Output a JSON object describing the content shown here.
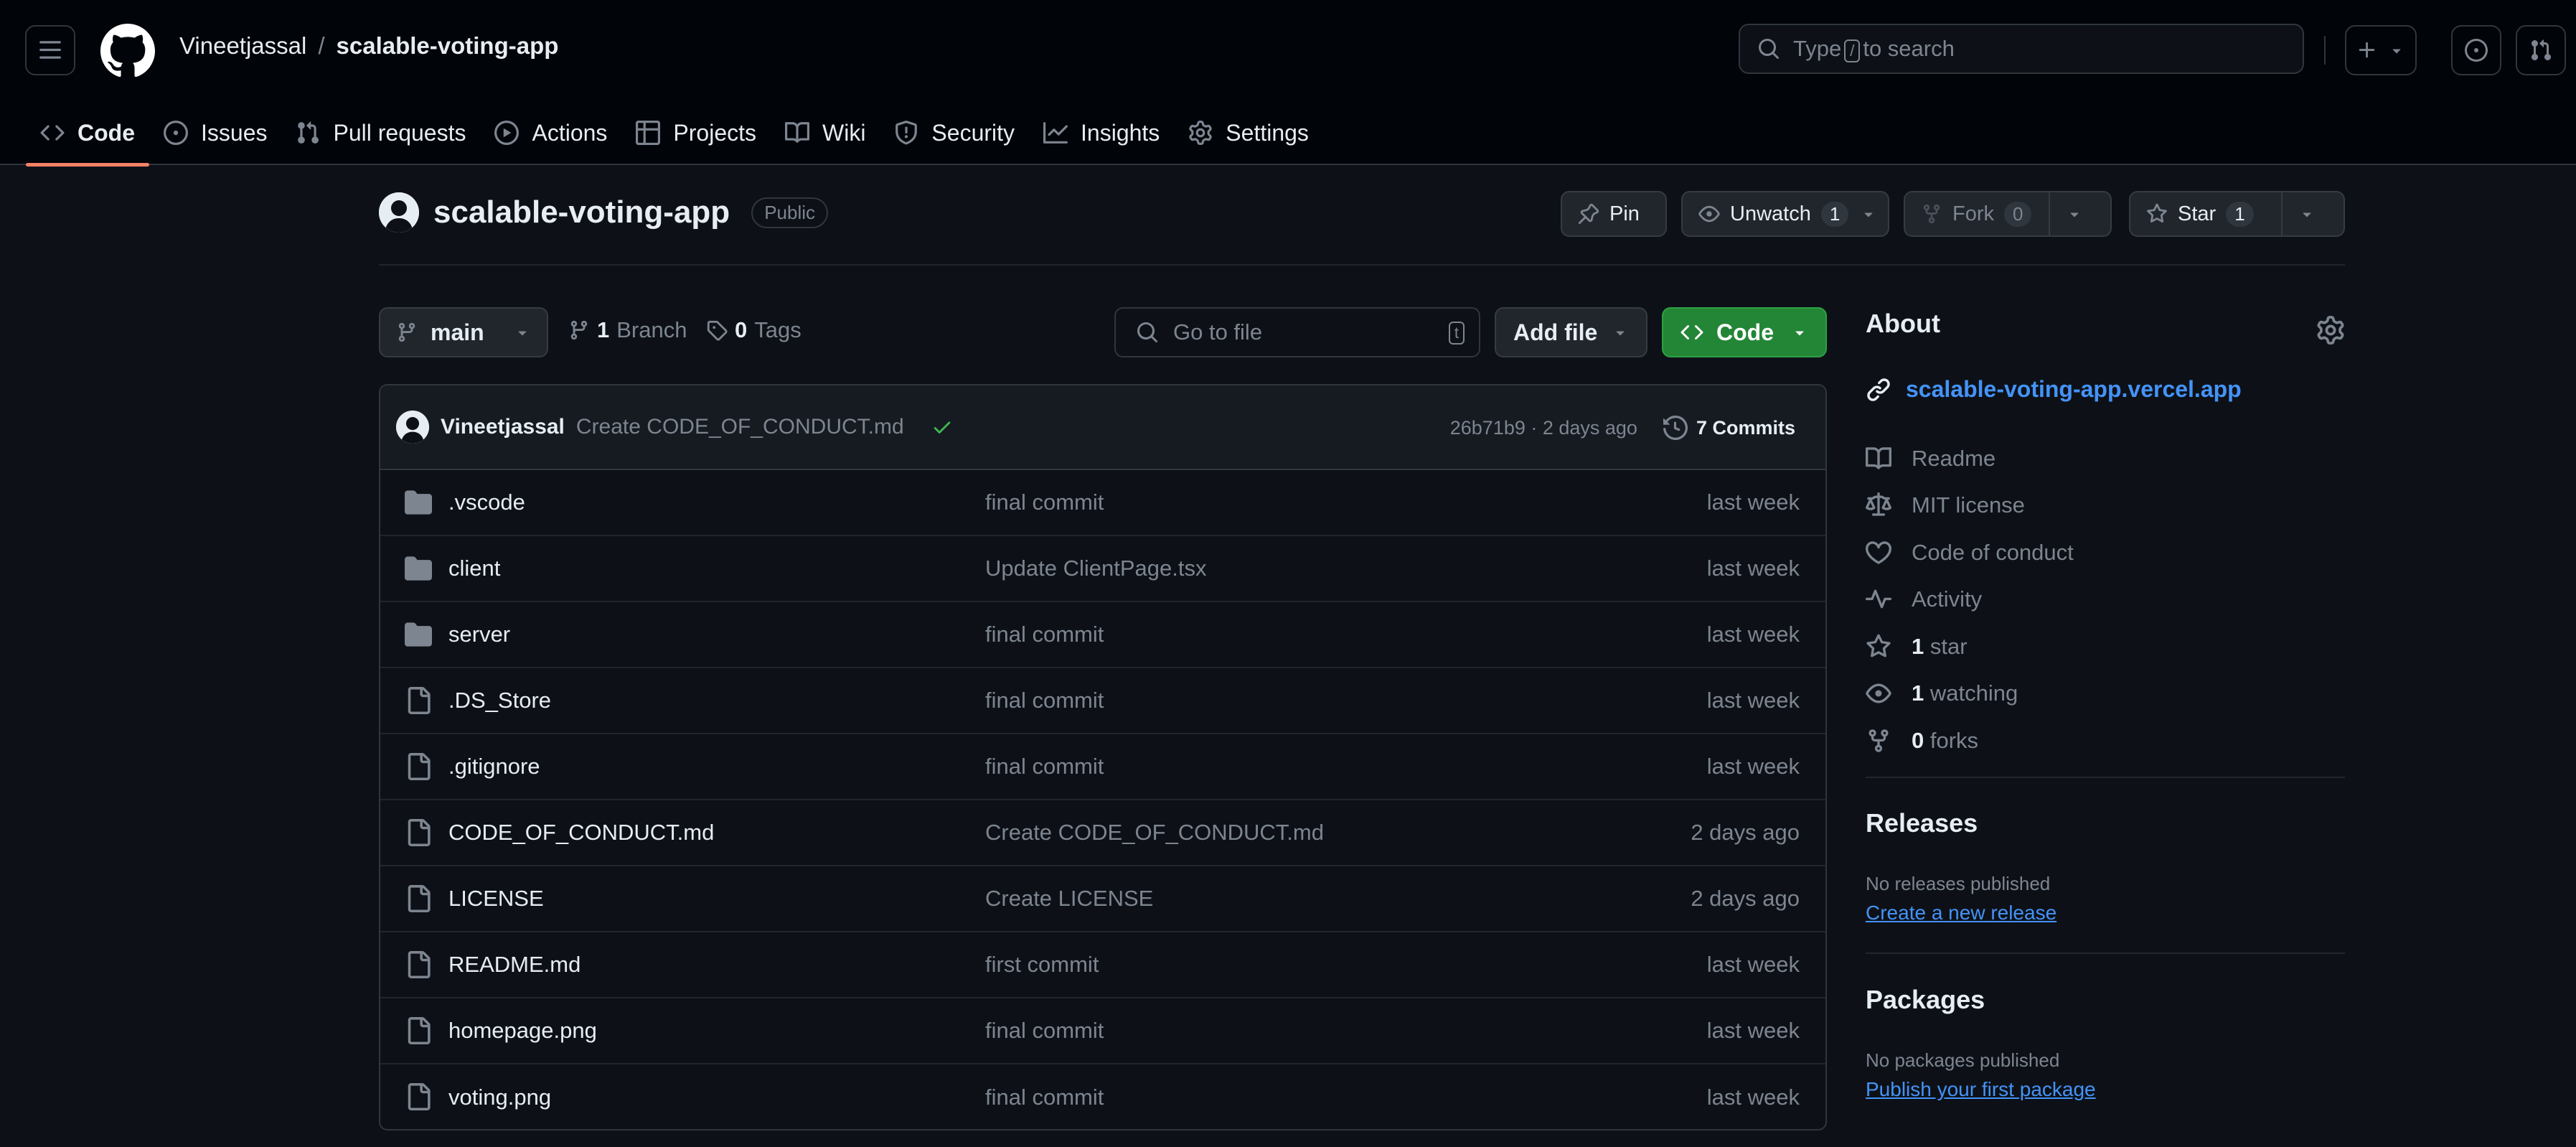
{
  "header": {
    "owner": "Vineetjassal",
    "separator": "/",
    "repo": "scalable-voting-app",
    "search_prefix": "Type",
    "search_key": "/",
    "search_suffix": "to search"
  },
  "tabs": [
    {
      "label": "Code",
      "icon": "code-icon"
    },
    {
      "label": "Issues",
      "icon": "issue-icon"
    },
    {
      "label": "Pull requests",
      "icon": "pull-request-icon"
    },
    {
      "label": "Actions",
      "icon": "play-icon"
    },
    {
      "label": "Projects",
      "icon": "table-icon"
    },
    {
      "label": "Wiki",
      "icon": "book-icon"
    },
    {
      "label": "Security",
      "icon": "shield-icon"
    },
    {
      "label": "Insights",
      "icon": "graph-icon"
    },
    {
      "label": "Settings",
      "icon": "gear-icon"
    }
  ],
  "repo_head": {
    "name": "scalable-voting-app",
    "visibility": "Public",
    "pin": "Pin",
    "unwatch": "Unwatch",
    "watch_count": "1",
    "fork": "Fork",
    "fork_count": "0",
    "star": "Star",
    "star_count": "1"
  },
  "toolbar": {
    "branch": "main",
    "branch_count": "1",
    "branch_label": "Branch",
    "tag_count": "0",
    "tag_label": "Tags",
    "go_to_file": "Go to file",
    "go_to_file_key": "t",
    "add_file": "Add file",
    "code": "Code"
  },
  "commit": {
    "author": "Vineetjassal",
    "message": "Create CODE_OF_CONDUCT.md",
    "hash_time": "26b71b9 · 2 days ago",
    "commits_label": "7 Commits"
  },
  "files": [
    {
      "name": ".vscode",
      "type": "folder",
      "message": "final commit",
      "date": "last week"
    },
    {
      "name": "client",
      "type": "folder",
      "message": "Update ClientPage.tsx",
      "date": "last week"
    },
    {
      "name": "server",
      "type": "folder",
      "message": "final commit",
      "date": "last week"
    },
    {
      "name": ".DS_Store",
      "type": "file",
      "message": "final commit",
      "date": "last week"
    },
    {
      "name": ".gitignore",
      "type": "file",
      "message": "final commit",
      "date": "last week"
    },
    {
      "name": "CODE_OF_CONDUCT.md",
      "type": "file",
      "message": "Create CODE_OF_CONDUCT.md",
      "date": "2 days ago"
    },
    {
      "name": "LICENSE",
      "type": "file",
      "message": "Create LICENSE",
      "date": "2 days ago"
    },
    {
      "name": "README.md",
      "type": "file",
      "message": "first commit",
      "date": "last week"
    },
    {
      "name": "homepage.png",
      "type": "file",
      "message": "final commit",
      "date": "last week"
    },
    {
      "name": "voting.png",
      "type": "file",
      "message": "final commit",
      "date": "last week"
    }
  ],
  "about": {
    "title": "About",
    "homepage": "scalable-voting-app.vercel.app",
    "items": [
      {
        "label": "Readme",
        "icon": "book-icon"
      },
      {
        "label": "MIT license",
        "icon": "law-icon"
      },
      {
        "label": "Code of conduct",
        "icon": "heart-icon"
      },
      {
        "label": "Activity",
        "icon": "pulse-icon"
      },
      {
        "num": "1",
        "label": "star",
        "icon": "star-icon"
      },
      {
        "num": "1",
        "label": "watching",
        "icon": "eye-icon"
      },
      {
        "num": "0",
        "label": "forks",
        "icon": "fork-icon"
      }
    ]
  },
  "releases": {
    "title": "Releases",
    "empty": "No releases published",
    "link": "Create a new release"
  },
  "packages": {
    "title": "Packages",
    "empty": "No packages published",
    "link": "Publish your first package"
  },
  "colors": {
    "background": "#0d1117",
    "header": "#010409",
    "accent_link": "#4493f8",
    "green_button": "#238636",
    "tab_underline": "#f78166",
    "check": "#3fb950"
  }
}
